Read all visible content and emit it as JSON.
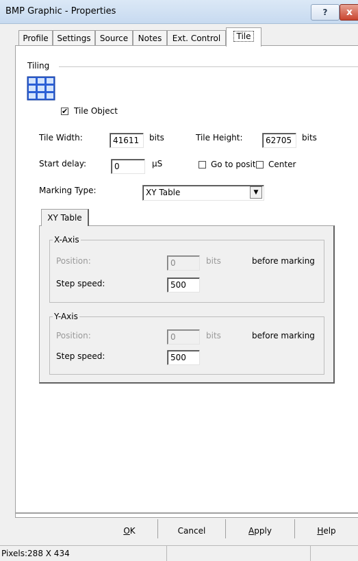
{
  "window": {
    "title": "BMP Graphic - Properties",
    "help_label": "?",
    "close_label": "x"
  },
  "tabs": [
    {
      "label": "Profile"
    },
    {
      "label": "Settings"
    },
    {
      "label": "Source"
    },
    {
      "label": "Notes"
    },
    {
      "label": "Ext. Control"
    },
    {
      "label": "Tile",
      "selected": true
    }
  ],
  "tiling": {
    "group_label": "Tiling",
    "icon": "tile-grid-icon",
    "tile_object_label": "Tile Object",
    "tile_object_checked": true,
    "tile_width_label": "Tile Width:",
    "tile_width_value": "41611",
    "tile_width_unit": "bits",
    "tile_height_label": "Tile Height:",
    "tile_height_value": "62705",
    "tile_height_unit": "bits",
    "start_delay_label": "Start delay:",
    "start_delay_value": "0",
    "start_delay_unit": "µS",
    "go_to_position_label": "Go to position",
    "go_to_position_checked": false,
    "center_label": "Center",
    "center_checked": false,
    "marking_type_label": "Marking Type:",
    "marking_type_value": "XY Table"
  },
  "xy_table": {
    "tab_label": "XY Table",
    "x_axis": {
      "title": "X-Axis",
      "position_label": "Position:",
      "position_value": "0",
      "position_unit": "bits",
      "position_suffix": "before marking",
      "step_speed_label": "Step speed:",
      "step_speed_value": "500"
    },
    "y_axis": {
      "title": "Y-Axis",
      "position_label": "Position:",
      "position_value": "0",
      "position_unit": "bits",
      "position_suffix": "before marking",
      "step_speed_label": "Step speed:",
      "step_speed_value": "500"
    }
  },
  "buttons": {
    "ok_mnemonic": "O",
    "ok_rest": "K",
    "cancel": "Cancel",
    "apply_mnemonic": "A",
    "apply_rest": "pply",
    "help_mnemonic": "H",
    "help_rest": "elp"
  },
  "status": {
    "pixels": "Pixels:288 X 434"
  },
  "colors": {
    "titlebar": "#c7daf0",
    "close_button": "#c9442e",
    "dialog_bg": "#f0f0f0"
  }
}
